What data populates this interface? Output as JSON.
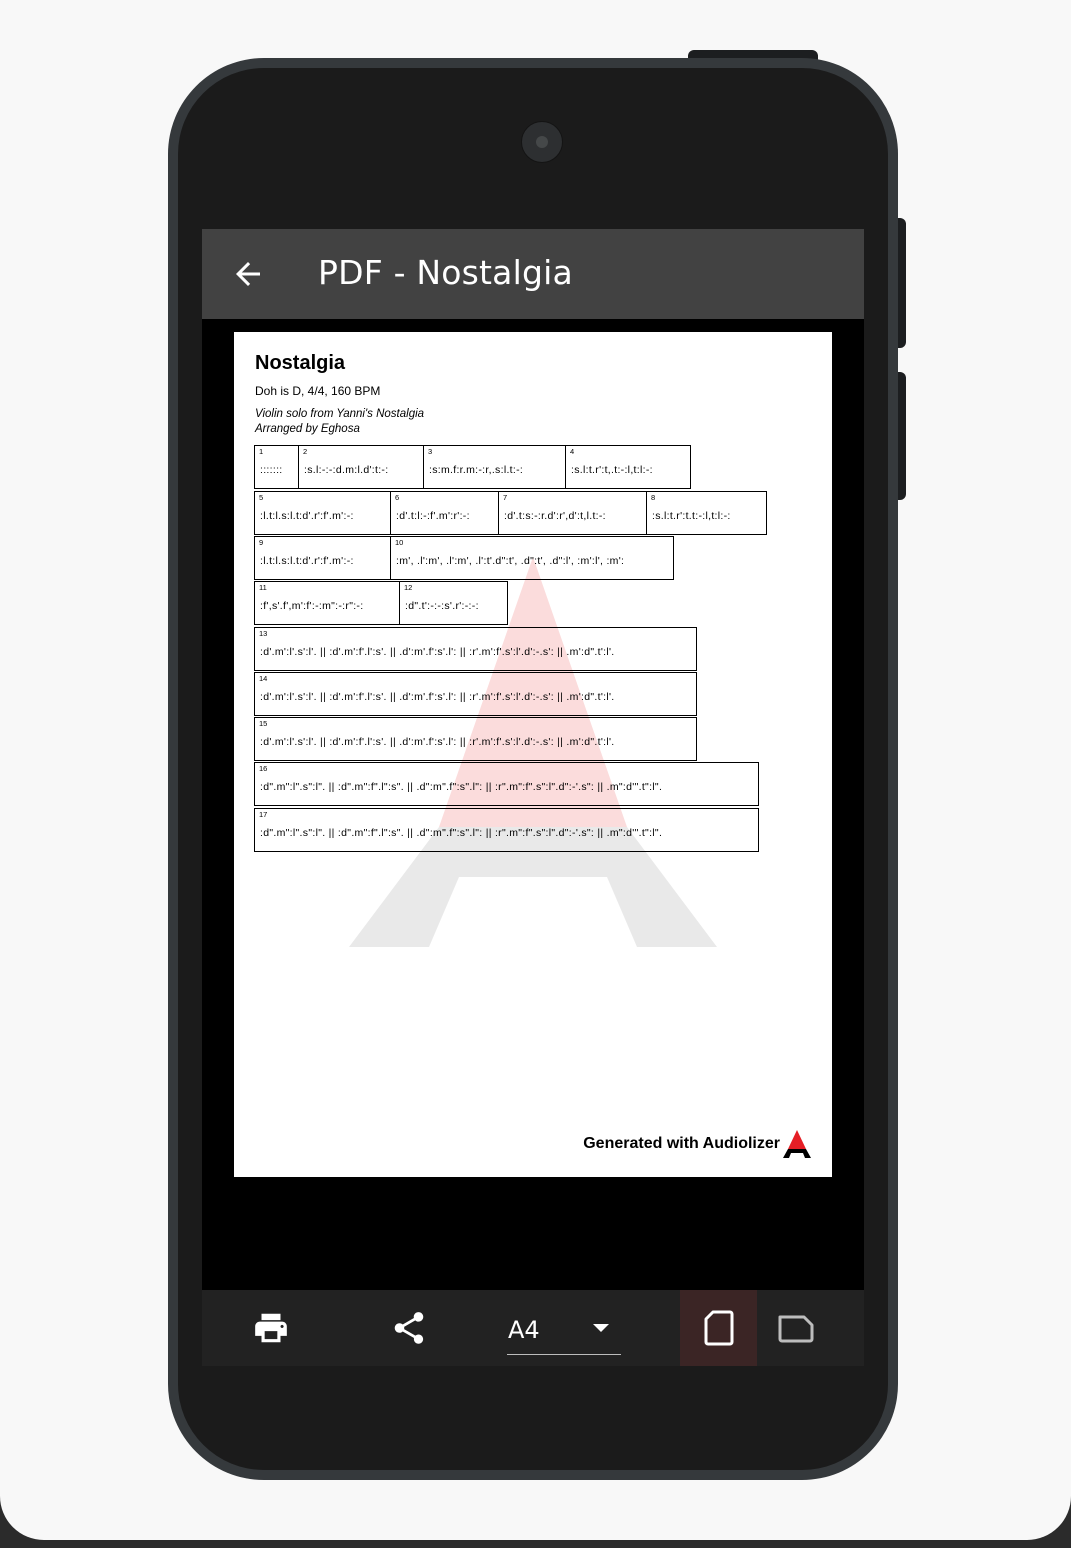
{
  "appbar": {
    "title": "PDF - Nostalgia"
  },
  "pdf": {
    "title": "Nostalgia",
    "meta": "Doh is D, 4/4, 160 BPM",
    "subtitle_line1": "Violin solo from Yanni's Nostalgia",
    "subtitle_line2": "Arranged by Eghosa",
    "footer": "Generated with Audiolizer",
    "bars": [
      {
        "num": "1",
        "text": ":::::::"
      },
      {
        "num": "2",
        "text": ":s.l:-:-:d.m:l.d':t:-:"
      },
      {
        "num": "3",
        "text": ":s:m.f:r.m:-:r,.s:l.t:-:"
      },
      {
        "num": "4",
        "text": ":s.l:t.r':t,.t:-:l,t:l:-:"
      },
      {
        "num": "5",
        "text": ":l.t:l.s:l.t:d'.r':f'.m':-:"
      },
      {
        "num": "6",
        "text": ":d'.t:l:-:f'.m':r':-:"
      },
      {
        "num": "7",
        "text": ":d'.t:s:-:r.d':r',d':t,l.t:-:"
      },
      {
        "num": "8",
        "text": ":s.l:t.r':t.t:-:l,t:l:-:"
      },
      {
        "num": "9",
        "text": ":l.t:l.s:l.t:d'.r':f'.m':-:"
      },
      {
        "num": "10",
        "text": ":m', .l':m', .l':m', .l':t'.d\":t', .d\":t', .d\":l', :m':l', :m':"
      },
      {
        "num": "11",
        "text": ":f',s'.f',m':f':-:m\":-:r\":-:"
      },
      {
        "num": "12",
        "text": ":d\".t':-:-:s'.r':-:-:"
      },
      {
        "num": "13",
        "text": ":d'.m':l'.s':l'. || :d'.m':f'.l':s'. || .d':m'.f':s'.l': || :r'.m':f'.s':l'.d':-.s': || .m':d\".t':l'."
      },
      {
        "num": "14",
        "text": ":d'.m':l'.s':l'. || :d'.m':f'.l':s'. || .d':m'.f':s'.l': || :r'.m':f'.s':l'.d':-.s': || .m':d\".t':l'."
      },
      {
        "num": "15",
        "text": ":d'.m':l'.s':l'. || :d'.m':f'.l':s'. || .d':m'.f':s'.l': || :r'.m':f'.s':l'.d':-.s': || .m':d\".t':l'."
      },
      {
        "num": "16",
        "text": ":d\".m\":l\".s\":l\". || :d\".m\":f\".l\":s\". || .d\":m\".f\":s\".l\": || :r\".m\":f\".s\":l\".d\":-'.s\": || .m\":d'\".t\":l\"."
      },
      {
        "num": "17",
        "text": ":d\".m\":l\".s\":l\". || :d\".m\":f\".l\":s\". || .d\":m\".f\":s\".l\": || :r\".m\":f\".s\":l\".d\":-'.s\": || .m\":d'\".t\":l\"."
      }
    ]
  },
  "bottombar": {
    "paper_size": "A4",
    "icons": [
      "print-icon",
      "share-icon",
      "portrait-icon",
      "landscape-icon"
    ]
  },
  "colors": {
    "appbar": "#424242",
    "bottombar": "#222222",
    "selected_orientation": "#3b2525"
  }
}
